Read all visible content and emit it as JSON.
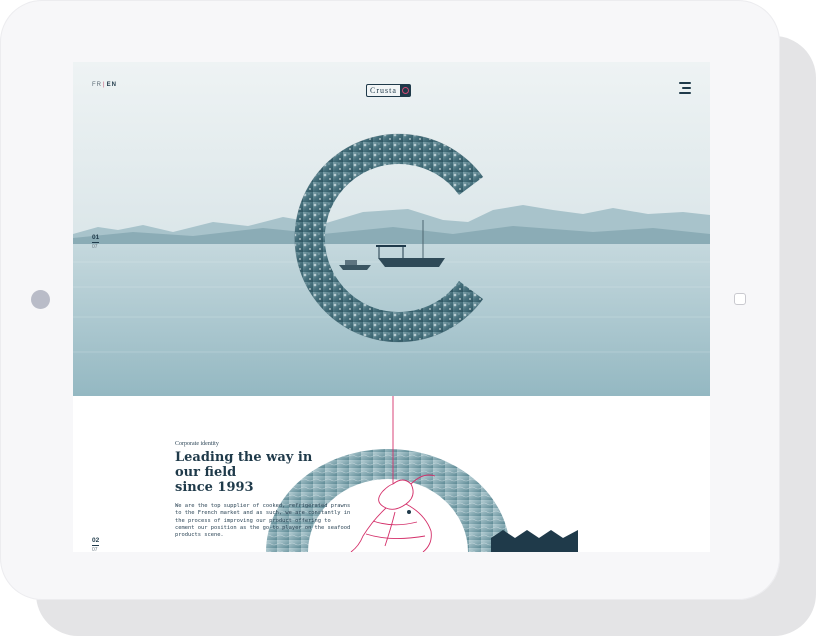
{
  "device": {
    "orientation": "landscape",
    "frame_color": "#f7f7f9"
  },
  "header": {
    "languages": [
      "FR",
      "EN"
    ],
    "language_separator": "|",
    "active_language": "EN",
    "logo_text": "Crusta"
  },
  "hero": {
    "current_slide": "01",
    "total_slides": "07",
    "big_letter_icon": "c-letter-photo-mask"
  },
  "corporate": {
    "kicker": "Corporate identity",
    "headline_lines": [
      "Leading the way in",
      "our field",
      "since 1993"
    ],
    "body": "We are the top supplier of cooked, refrigerated prawns to the French market and as such, we are constantly in the process of improving our product offering to cement our position as the go-to player on the seafood products scene.",
    "current_slide": "02",
    "total_slides": "07"
  },
  "colors": {
    "navy": "#1f3a4a",
    "accent_pink": "#d4306a",
    "sea": "#a9c6cf",
    "sky": "#e6eef0"
  }
}
